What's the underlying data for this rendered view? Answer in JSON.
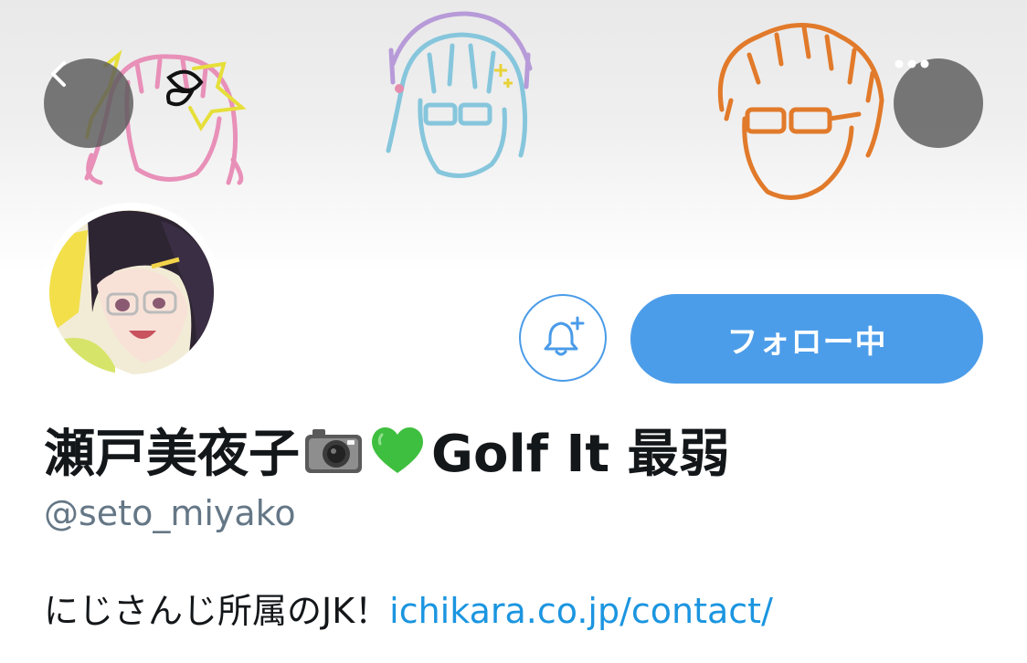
{
  "profile": {
    "name_part1": "瀬戸美夜子",
    "name_part2": "Golf It 最弱",
    "emoji_1": "camera-emoji",
    "emoji_2": "green-heart-emoji",
    "handle": "@seto_miyako",
    "bio_text": "にじさんじ所属のJK！",
    "bio_link": "ichikara.co.jp/contact/"
  },
  "actions": {
    "follow_label": "フォロー中",
    "back_icon": "chevron-left-icon",
    "more_icon": "more-dots-icon",
    "notify_icon": "bell-plus-icon"
  },
  "colors": {
    "accent": "#4c9de9",
    "link": "#1b95e0",
    "handle": "#657786",
    "text": "#14171a"
  }
}
